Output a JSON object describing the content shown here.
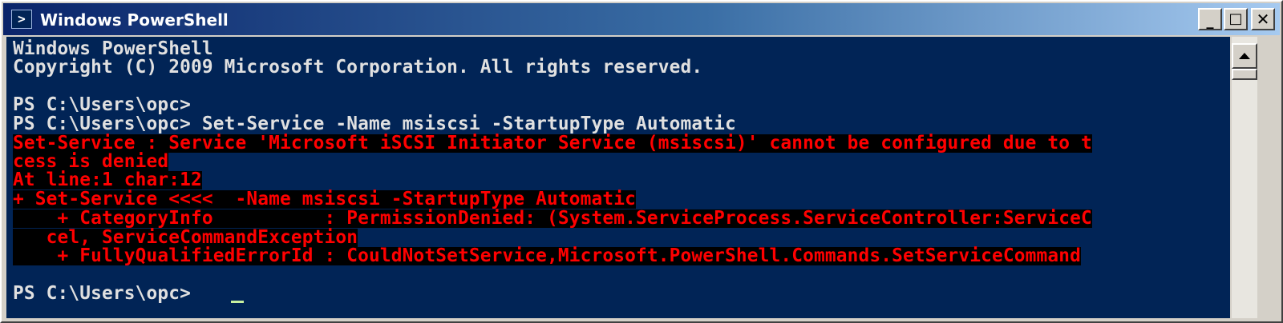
{
  "window": {
    "title": "Windows PowerShell",
    "icon": "powershell-icon",
    "buttons": {
      "minimize": "_",
      "maximize": "□",
      "close": "✕"
    }
  },
  "console": {
    "lines": [
      "Windows PowerShell",
      "Copyright (C) 2009 Microsoft Corporation. All rights reserved.",
      "",
      "PS C:\\Users\\opc>",
      "PS C:\\Users\\opc> Set-Service -Name msiscsi -StartupType Automatic",
      "Set-Service : Service 'Microsoft iSCSI Initiator Service (msiscsi)' cannot be configured due to t",
      "cess is denied",
      "At line:1 char:12",
      "+ Set-Service <<<<  -Name msiscsi -StartupType Automatic",
      "    + CategoryInfo          : PermissionDenied: (System.ServiceProcess.ServiceController:ServiceC",
      "   cel, ServiceCommandException",
      "    + FullyQualifiedErrorId : CouldNotSetService,Microsoft.PowerShell.Commands.SetServiceCommand",
      "",
      "PS C:\\Users\\opc> "
    ],
    "colors": {
      "background": "#012456",
      "text": "#e0e0e0",
      "error_text": "#ff0000",
      "error_background": "#000000"
    }
  }
}
